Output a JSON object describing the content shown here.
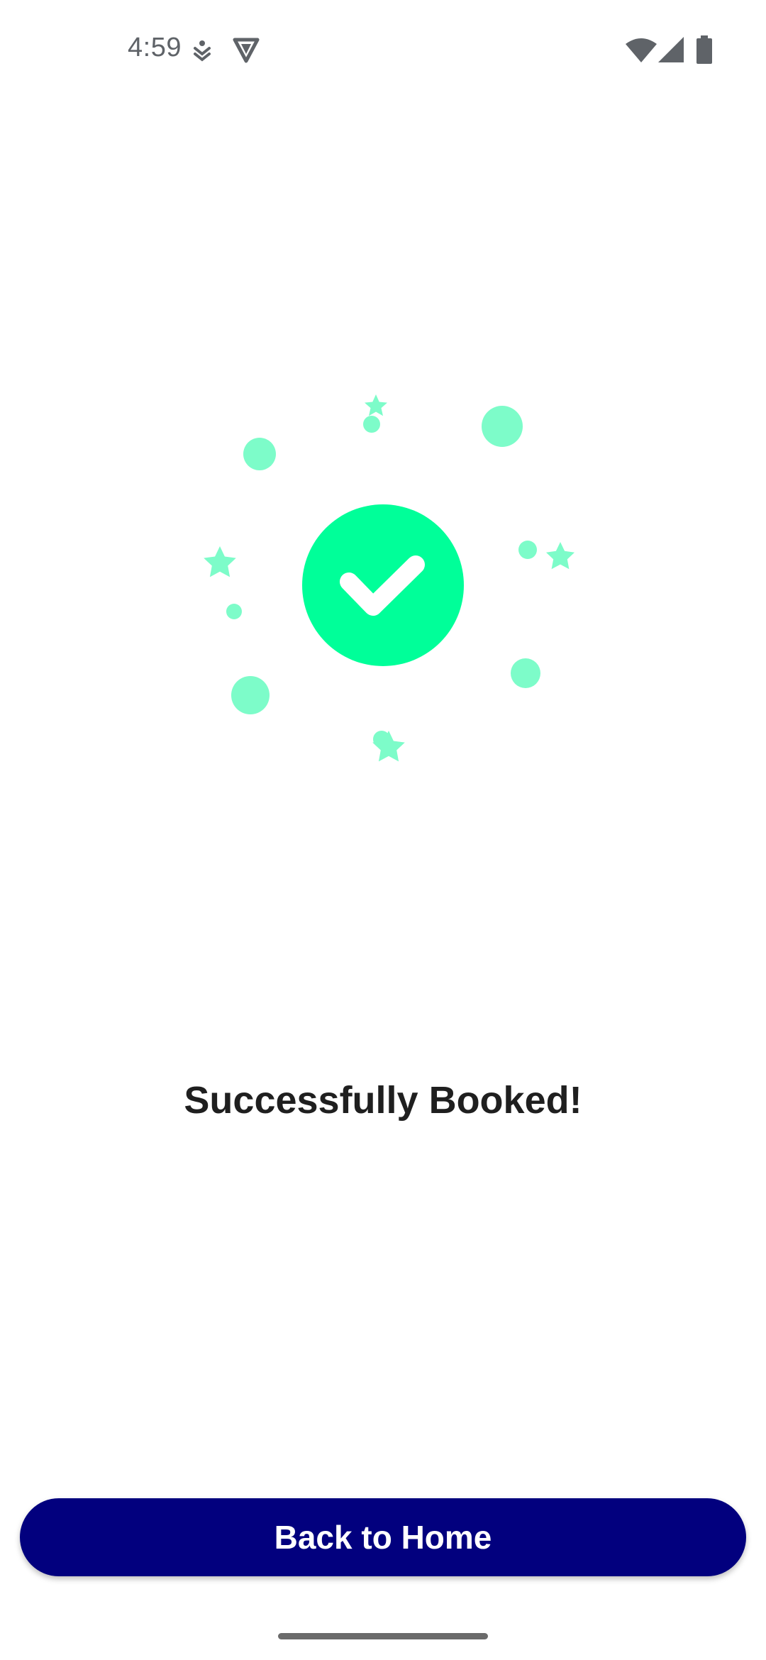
{
  "status_bar": {
    "time": "4:59",
    "left_icons": [
      "accessibility-download-icon",
      "vpn-shield-icon"
    ],
    "right_icons": [
      "wifi-icon",
      "cellular-signal-icon",
      "battery-icon"
    ]
  },
  "illustration": {
    "center_icon": "check-icon",
    "accent_color": "#00ff99",
    "confetti_color": "#7dfcc9",
    "decorations": [
      "circle",
      "star"
    ]
  },
  "main": {
    "title": "Successfully Booked!"
  },
  "actions": {
    "back_to_home_label": "Back to Home",
    "button_color": "#02007e"
  },
  "system": {
    "gesture_bar": "home-gesture-bar"
  }
}
